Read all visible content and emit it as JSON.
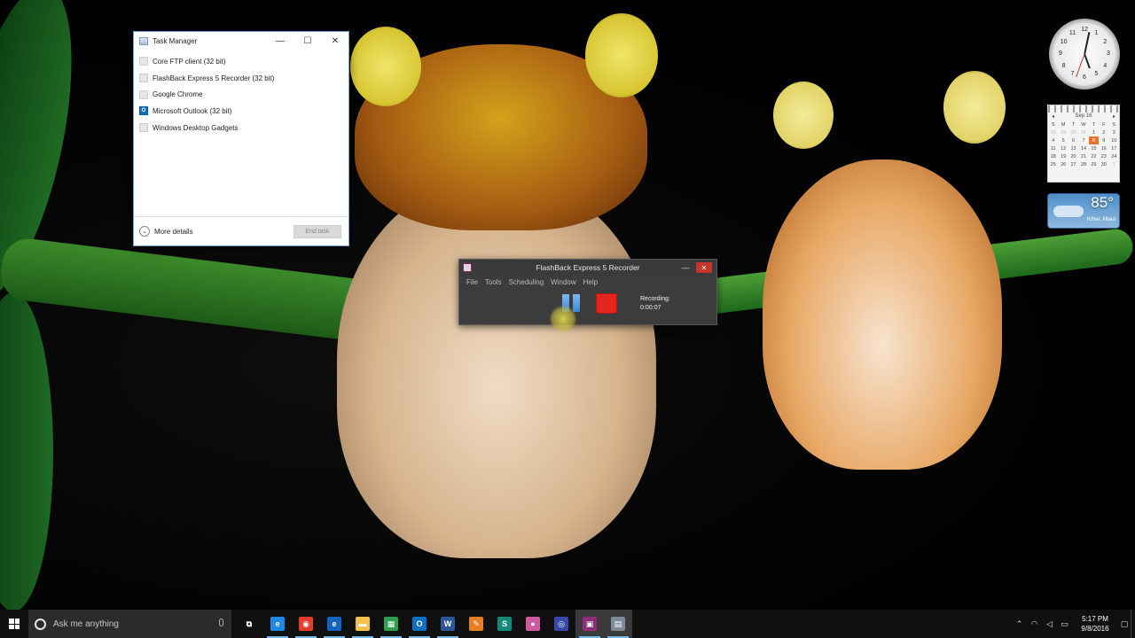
{
  "task_manager": {
    "title": "Task Manager",
    "apps": [
      {
        "name": "Core FTP client (32 bit)",
        "icon": "app-icon"
      },
      {
        "name": "FlashBack Express 5 Recorder (32 bit)",
        "icon": "app-icon"
      },
      {
        "name": "Google Chrome",
        "icon": "app-icon"
      },
      {
        "name": "Microsoft Outlook (32 bit)",
        "icon": "outlook-icon"
      },
      {
        "name": "Windows Desktop Gadgets",
        "icon": "app-icon"
      }
    ],
    "more_details": "More details",
    "end_task": "End task"
  },
  "recorder": {
    "title": "FlashBack Express 5 Recorder",
    "menu": [
      "File",
      "Tools",
      "Scheduling",
      "Window",
      "Help"
    ],
    "status_label": "Recording:",
    "elapsed": "0:00:07",
    "stop_color": "#e52420",
    "pause_color": "#4f94dc"
  },
  "gadgets": {
    "clock": {
      "numbers": [
        "12",
        "1",
        "2",
        "3",
        "4",
        "5",
        "6",
        "7",
        "8",
        "9",
        "10",
        "11"
      ]
    },
    "calendar": {
      "month": "Sep 16",
      "weekdays": [
        "S",
        "M",
        "T",
        "W",
        "T",
        "F",
        "S"
      ],
      "weeks": [
        [
          "28",
          "29",
          "30",
          "31",
          "1",
          "2",
          "3"
        ],
        [
          "4",
          "5",
          "6",
          "7",
          "8",
          "9",
          "10"
        ],
        [
          "11",
          "12",
          "13",
          "14",
          "15",
          "16",
          "17"
        ],
        [
          "18",
          "19",
          "20",
          "21",
          "22",
          "23",
          "24"
        ],
        [
          "25",
          "26",
          "27",
          "28",
          "29",
          "30",
          "1"
        ]
      ],
      "today": "8"
    },
    "weather": {
      "temperature": "85°",
      "location": "Kihei, Maui"
    }
  },
  "taskbar": {
    "search_placeholder": "Ask me anything",
    "apps": [
      {
        "name": "task-view",
        "glyph": "⧉",
        "color": "#101010"
      },
      {
        "name": "internet-explorer",
        "glyph": "e",
        "color": "#1e88e5"
      },
      {
        "name": "chrome",
        "glyph": "◉",
        "color": "#e33b2e"
      },
      {
        "name": "edge",
        "glyph": "e",
        "color": "#1565c0"
      },
      {
        "name": "file-explorer",
        "glyph": "▬",
        "color": "#f2c14e"
      },
      {
        "name": "excel-like-app",
        "glyph": "▦",
        "color": "#2e9e4f"
      },
      {
        "name": "outlook",
        "glyph": "O",
        "color": "#0f6fc5"
      },
      {
        "name": "word",
        "glyph": "W",
        "color": "#2b579a"
      },
      {
        "name": "paint-app",
        "glyph": "✎",
        "color": "#e67e22"
      },
      {
        "name": "sway-app",
        "glyph": "S",
        "color": "#128a7a"
      },
      {
        "name": "color-picker-app",
        "glyph": "●",
        "color": "#d05aa0"
      },
      {
        "name": "firefox-like-app",
        "glyph": "◎",
        "color": "#3949ab"
      },
      {
        "name": "flashback-app",
        "glyph": "▣",
        "color": "#8c2d7a"
      },
      {
        "name": "task-manager-app",
        "glyph": "▤",
        "color": "#7d8a99"
      }
    ],
    "time": "5:17 PM",
    "date": "9/8/2016"
  }
}
